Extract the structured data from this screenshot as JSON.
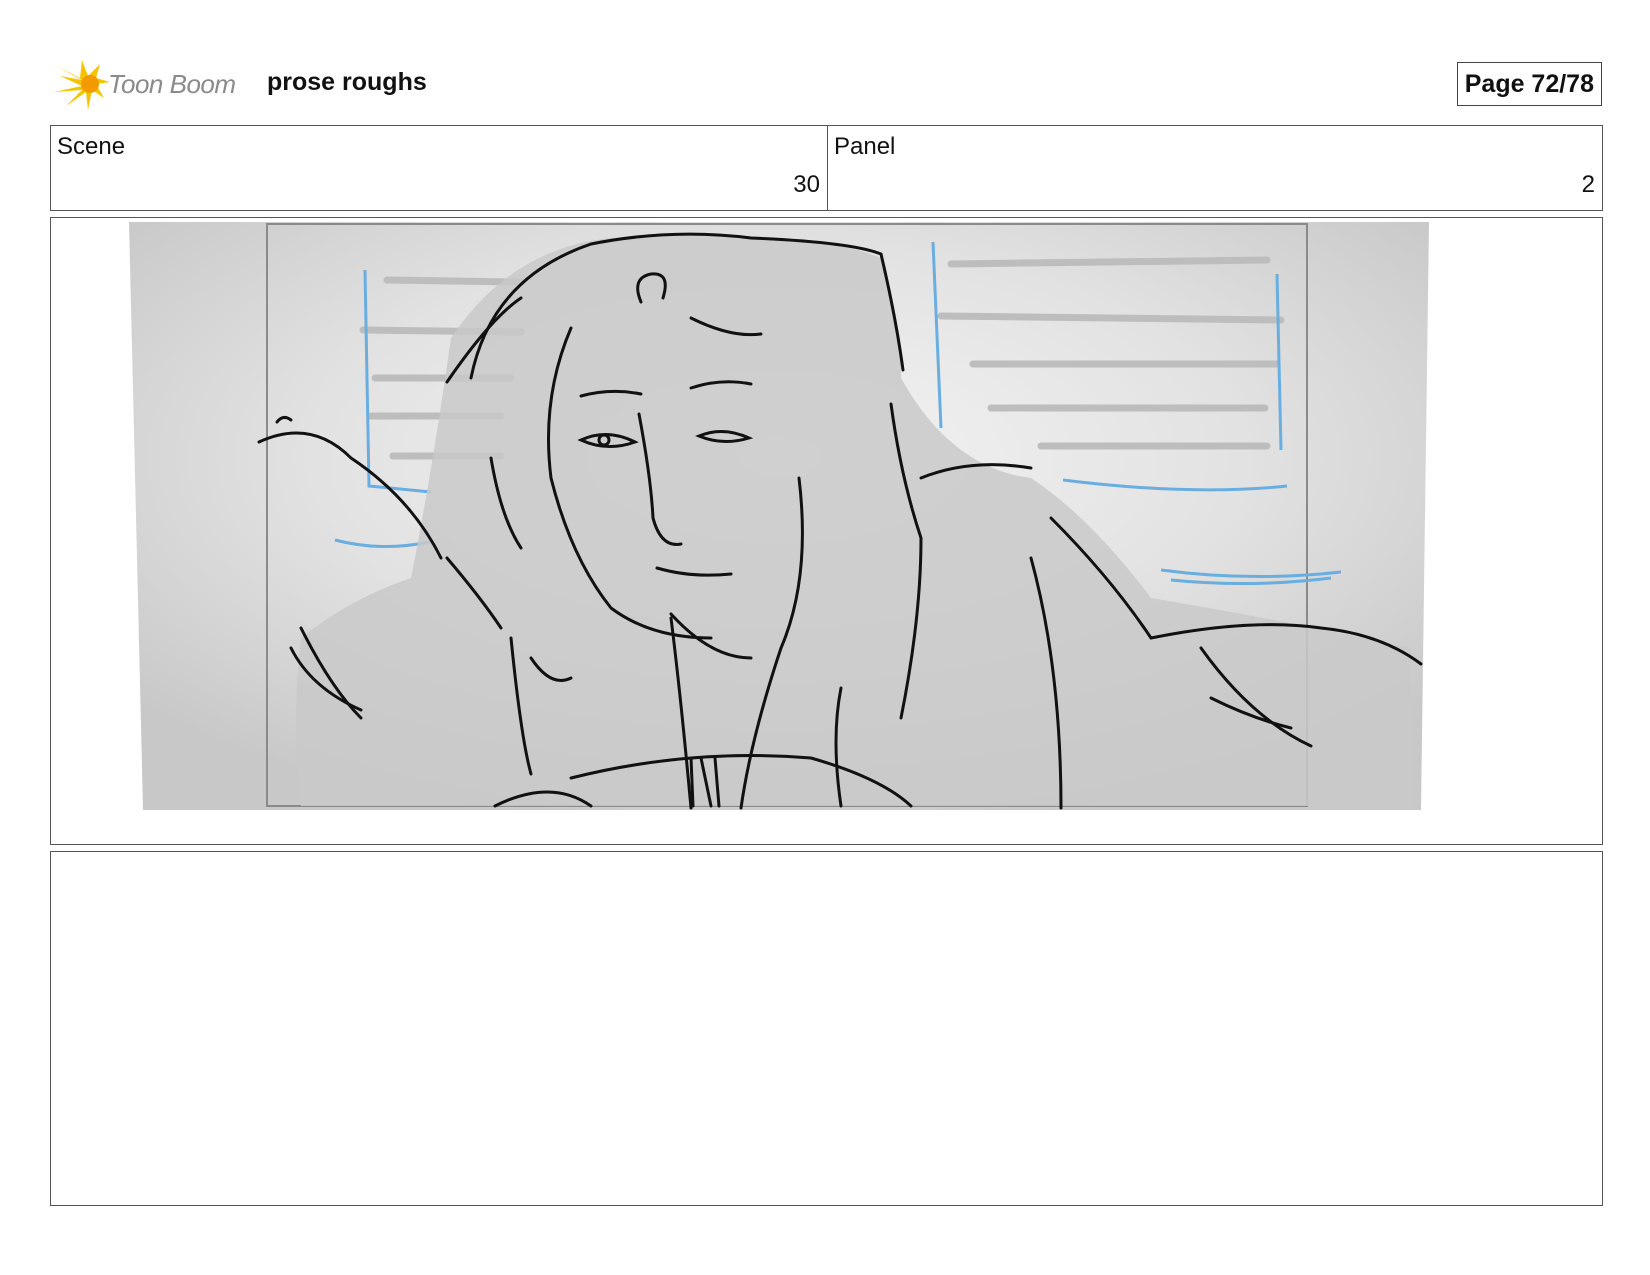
{
  "header": {
    "logo_text": "Toon Boom",
    "project_title": "prose roughs",
    "page_label": "Page 72/78"
  },
  "info": {
    "scene_label": "Scene",
    "scene_value": "30",
    "panel_label": "Panel",
    "panel_value": "2"
  },
  "panel_image": {
    "description_icon": "storyboard-sketch"
  },
  "notes": {
    "text": ""
  },
  "colors": {
    "logo_yellow": "#f5c400",
    "logo_orange": "#f39a00",
    "sketch_gray": "#c9c9c9",
    "sketch_blue": "#6aaee0",
    "ink": "#111111"
  }
}
